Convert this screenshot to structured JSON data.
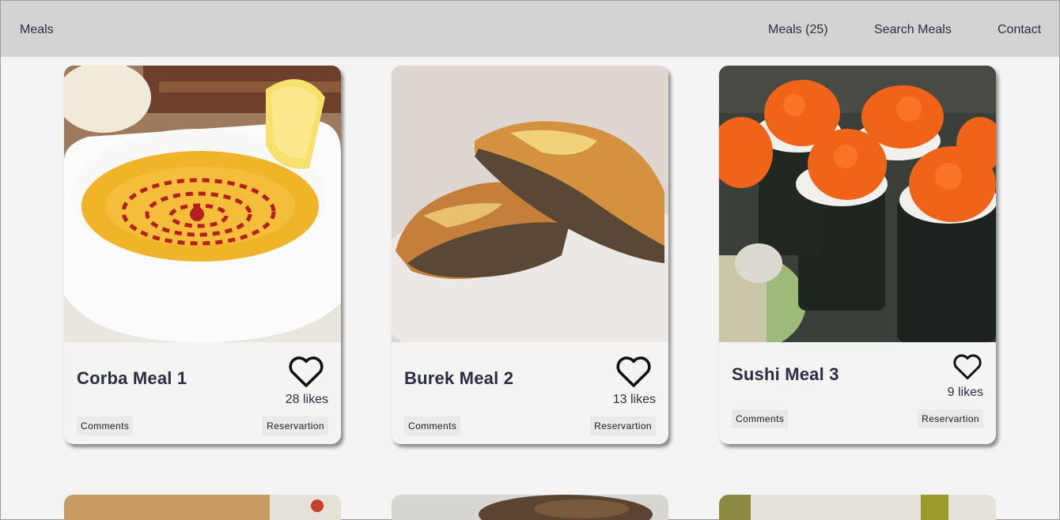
{
  "nav": {
    "brand": "Meals",
    "links": [
      "Meals (25)",
      "Search Meals",
      "Contact"
    ]
  },
  "cards": [
    {
      "title": "Corba Meal 1",
      "likes": "28 likes",
      "comments_label": "Comments",
      "reservation_label": "Reservartion"
    },
    {
      "title": "Burek Meal 2",
      "likes": "13 likes",
      "comments_label": "Comments",
      "reservation_label": "Reservartion"
    },
    {
      "title": "Sushi Meal 3",
      "likes": "9 likes",
      "comments_label": "Comments",
      "reservation_label": "Reservartion"
    }
  ],
  "icons": {
    "like": "heart-outline-icon"
  },
  "colors": {
    "navbar": "#d3d3d3",
    "background": "#f4f4f4",
    "text": "#2b2d42",
    "button_bg": "#e9e9e9"
  }
}
